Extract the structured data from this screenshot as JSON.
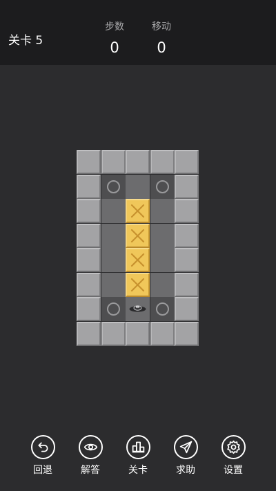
{
  "header": {
    "level_title": "关卡 5",
    "steps_label": "步数",
    "steps_value": "0",
    "moves_label": "移动",
    "moves_value": "0"
  },
  "board": {
    "cols": 5,
    "rows": 8,
    "legend": {
      "W": "wall",
      "F": "floor",
      "G": "goal",
      "B": "box",
      "P": "player"
    },
    "grid": [
      "WWWWW",
      "WGFGW",
      "WFBFW",
      "WFBFW",
      "WFBFW",
      "WFBFW",
      "WGPGW",
      "WWWWW"
    ]
  },
  "colors": {
    "background": "#2c2c2e",
    "header": "#1c1c1e",
    "wall": "#a3a3a5",
    "floor": "#6c6c6e",
    "goal_floor": "#4e4e50",
    "box": "#f0c75a",
    "box_mark": "#c8922e"
  },
  "toolbar": {
    "items": [
      {
        "label": "回退",
        "icon": "undo-icon"
      },
      {
        "label": "解答",
        "icon": "eye-icon"
      },
      {
        "label": "关卡",
        "icon": "levels-icon"
      },
      {
        "label": "求助",
        "icon": "paper-plane-icon"
      },
      {
        "label": "设置",
        "icon": "gear-icon"
      }
    ]
  }
}
